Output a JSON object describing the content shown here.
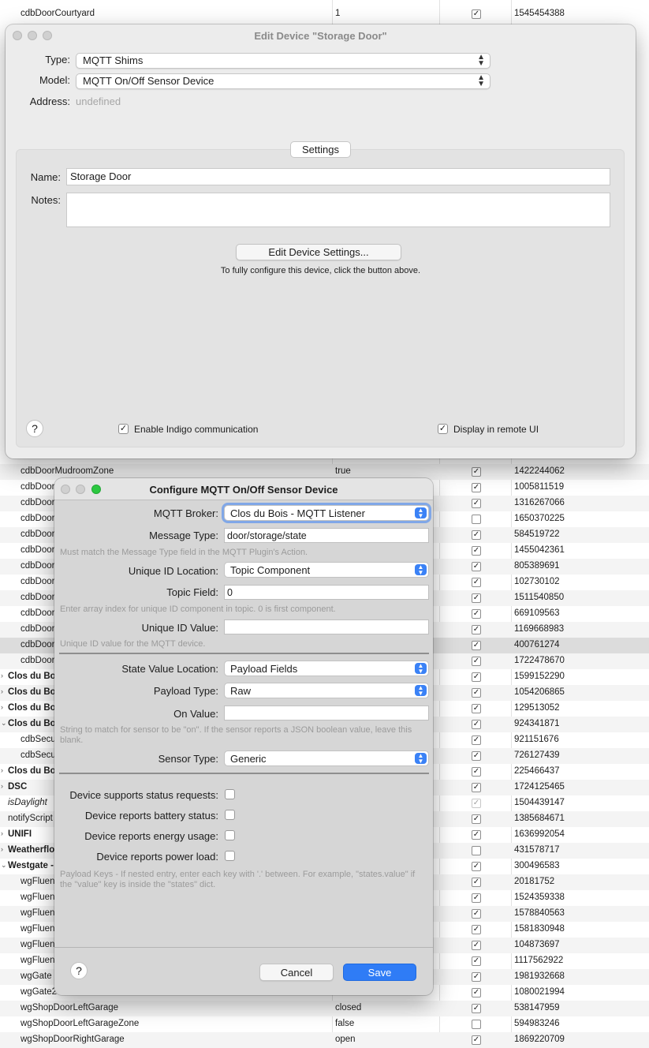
{
  "background_table": {
    "rows": [
      {
        "name": "cdbDoorCourtyard",
        "value": "1",
        "checked": true,
        "id": "1545454388"
      },
      {
        "name": "cdbDoorMudroomZone",
        "value": "true",
        "checked": true,
        "id": "1422244062"
      },
      {
        "name": "cdbDoor",
        "value": "",
        "checked": true,
        "id": "1005811519"
      },
      {
        "name": "cdbDoor",
        "value": "",
        "checked": true,
        "id": "1316267066"
      },
      {
        "name": "cdbDoor",
        "value": "",
        "checked": false,
        "id": "1650370225"
      },
      {
        "name": "cdbDoor",
        "value": "",
        "checked": true,
        "id": "584519722"
      },
      {
        "name": "cdbDoor",
        "value": "",
        "checked": true,
        "id": "1455042361"
      },
      {
        "name": "cdbDoor",
        "value": "",
        "checked": true,
        "id": "805389691"
      },
      {
        "name": "cdbDoor",
        "value": "",
        "checked": true,
        "id": "102730102"
      },
      {
        "name": "cdbDoor",
        "value": "",
        "checked": true,
        "id": "1511540850"
      },
      {
        "name": "cdbDoor",
        "value": "",
        "checked": true,
        "id": "669109563"
      },
      {
        "name": "cdbDoor",
        "value": "",
        "checked": true,
        "id": "1169668983"
      },
      {
        "name": "cdbDoor",
        "value": "",
        "checked": true,
        "id": "400761274"
      },
      {
        "name": "cdbDoor",
        "value": "",
        "checked": true,
        "id": "1722478670"
      },
      {
        "name": "Clos du Bo",
        "value": "",
        "checked": true,
        "id": "1599152290"
      },
      {
        "name": "Clos du Bo",
        "value": "",
        "checked": true,
        "id": "1054206865"
      },
      {
        "name": "Clos du Bo",
        "value": "",
        "checked": true,
        "id": "129513052"
      },
      {
        "name": "Clos du Bo",
        "value": "",
        "checked": true,
        "id": "924341871"
      },
      {
        "name": "cdbSecu",
        "value": "",
        "checked": true,
        "id": "921151676"
      },
      {
        "name": "cdbSecu",
        "value": "",
        "checked": true,
        "id": "726127439"
      },
      {
        "name": "Clos du Bo",
        "value": "",
        "checked": true,
        "id": "225466437"
      },
      {
        "name": "DSC",
        "value": "",
        "checked": true,
        "id": "1724125465"
      },
      {
        "name": "isDaylight",
        "value": "",
        "checked": true,
        "id": "1504439147"
      },
      {
        "name": "notifyScript",
        "value": "",
        "checked": true,
        "id": "1385684671"
      },
      {
        "name": "UNIFI",
        "value": "",
        "checked": true,
        "id": "1636992054"
      },
      {
        "name": "Weatherflo",
        "value": "",
        "checked": false,
        "id": "431578717"
      },
      {
        "name": "Westgate -",
        "value": "",
        "checked": true,
        "id": "300496583"
      },
      {
        "name": "wgFluen",
        "value": "",
        "checked": true,
        "id": "20181752"
      },
      {
        "name": "wgFluen",
        "value": "",
        "checked": true,
        "id": "1524359338"
      },
      {
        "name": "wgFluen",
        "value": "",
        "checked": true,
        "id": "1578840563"
      },
      {
        "name": "wgFluen",
        "value": "",
        "checked": true,
        "id": "1581830948"
      },
      {
        "name": "wgFluen",
        "value": "",
        "checked": true,
        "id": "104873697"
      },
      {
        "name": "wgFluen",
        "value": "",
        "checked": true,
        "id": "1117562922"
      },
      {
        "name": "wgGate",
        "value": "",
        "checked": true,
        "id": "1981932668"
      },
      {
        "name": "wgGate2",
        "value": "",
        "checked": true,
        "id": "1080021994"
      },
      {
        "name": "wgShopDoorLeftGarage",
        "value": "closed",
        "checked": true,
        "id": "538147959"
      },
      {
        "name": "wgShopDoorLeftGarageZone",
        "value": "false",
        "checked": false,
        "id": "594983246"
      },
      {
        "name": "wgShopDoorRightGarage",
        "value": "open",
        "checked": true,
        "id": "1869220709"
      }
    ]
  },
  "edit_window": {
    "title": "Edit Device \"Storage Door\"",
    "type_label": "Type:",
    "type_value": "MQTT Shims",
    "model_label": "Model:",
    "model_value": "MQTT On/Off Sensor Device",
    "address_label": "Address:",
    "address_value": "undefined",
    "settings_tab": "Settings",
    "name_label": "Name:",
    "name_value": "Storage Door",
    "notes_label": "Notes:",
    "notes_value": "",
    "edit_settings_button": "Edit Device Settings...",
    "edit_settings_hint": "To fully configure this device, click the button above.",
    "help_label": "?",
    "enable_comm_label": "Enable Indigo communication",
    "enable_comm_checked": true,
    "remote_ui_label": "Display in remote UI",
    "remote_ui_checked": true
  },
  "configure_window": {
    "title": "Configure MQTT On/Off Sensor Device",
    "broker_label": "MQTT Broker:",
    "broker_value": "Clos du Bois - MQTT Listener",
    "message_type_label": "Message Type:",
    "message_type_value": "door/storage/state",
    "message_type_hint": "Must match the Message Type field in the MQTT Plugin's Action.",
    "uid_location_label": "Unique ID Location:",
    "uid_location_value": "Topic Component",
    "topic_field_label": "Topic Field:",
    "topic_field_value": "0",
    "topic_field_hint": "Enter array index for unique ID component in topic.  0 is first component.",
    "uid_value_label": "Unique ID Value:",
    "uid_value_value": "",
    "uid_value_hint": "Unique ID value for the MQTT device.",
    "state_location_label": "State Value Location:",
    "state_location_value": "Payload Fields",
    "payload_type_label": "Payload Type:",
    "payload_type_value": "Raw",
    "on_value_label": "On Value:",
    "on_value_value": "",
    "on_value_hint": "String to match for sensor to be \"on\".  If the sensor reports a JSON boolean value, leave this blank.",
    "sensor_type_label": "Sensor Type:",
    "sensor_type_value": "Generic",
    "status_requests_label": "Device supports status requests:",
    "battery_label": "Device reports battery status:",
    "energy_label": "Device reports energy usage:",
    "power_label": "Device reports power load:",
    "payload_keys_hint": "Payload Keys - If nested entry, enter each key with '.' between.  For example, \"states.value\" if the \"value\" key is inside the \"states\" dict.",
    "help_label": "?",
    "cancel_label": "Cancel",
    "save_label": "Save"
  },
  "colors": {
    "accent": "#2f7cf6",
    "window_bg": "#ececec",
    "sheet_bg": "#d6d6d6",
    "close_button": "#ec6a5e",
    "minimize_button": "#f4bf4f",
    "zoom_button": "#2bc840"
  },
  "icons": {
    "popup_arrows": "up-down-chevron-icon",
    "checkmark": "checkmark-icon",
    "disclosure": "disclosure-triangle-icon"
  }
}
